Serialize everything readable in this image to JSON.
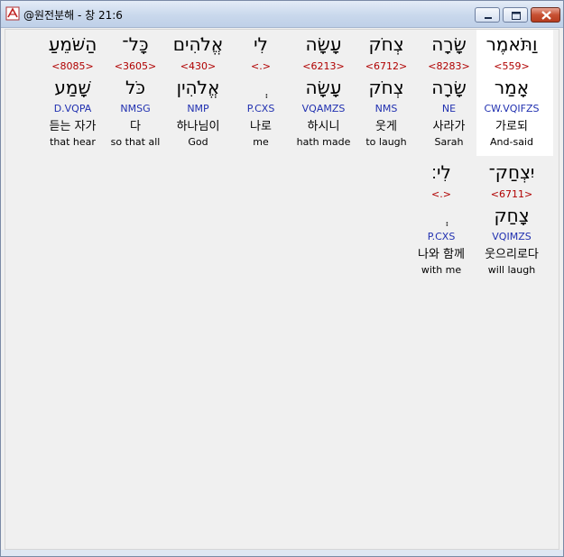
{
  "window": {
    "title": "@원전분해 - 창 21:6",
    "icon": "app-icon"
  },
  "controls": {
    "minimize": "minimize-icon",
    "maximize": "maximize-icon",
    "close": "close-icon"
  },
  "colors": {
    "strong": "#b00000",
    "morph": "#2030b0",
    "highlight": "#ffffff"
  },
  "rows": [
    [
      {
        "hebrew": "וַתֹּאמֶר",
        "strong": "<559>",
        "lemma": "אָמַר",
        "morph": "CW.VQIFZS",
        "korean": "가로되",
        "english": "And-said"
      },
      {
        "hebrew": "שָׂרָה",
        "strong": "<8283>",
        "lemma": "שָׂרָה",
        "morph": "NE",
        "korean": "사라가",
        "english": "Sarah"
      },
      {
        "hebrew": "צְחֹק",
        "strong": "<6712>",
        "lemma": "צְחֹק",
        "morph": "NMS",
        "korean": "웃게",
        "english": "to laugh"
      },
      {
        "hebrew": "עָשָׂה",
        "strong": "<6213>",
        "lemma": "עָשָׂה",
        "morph": "VQAMZS",
        "korean": "하시니",
        "english": "hath made"
      },
      {
        "hebrew": "לִי",
        "strong": "<.>",
        "lemma": "ְ",
        "morph": "P.CXS",
        "korean": "나로",
        "english": "me"
      },
      {
        "hebrew": "אֱלֹהִים",
        "strong": "<430>",
        "lemma": "אֱלֹהִין",
        "morph": "NMP",
        "korean": "하나님이",
        "english": "God"
      },
      {
        "hebrew": "כָּל־",
        "strong": "<3605>",
        "lemma": "כֹּל",
        "morph": "NMSG",
        "korean": "다",
        "english": "so that all"
      },
      {
        "hebrew": "הַשֹּׁמֵעַ",
        "strong": "<8085>",
        "lemma": "שָׁמַע",
        "morph": "D.VQPA",
        "korean": "듣는 자가",
        "english": "that hear"
      }
    ],
    [
      {
        "hebrew": "יִצְחַק־",
        "strong": "<6711>",
        "lemma": "צָחַק",
        "morph": "VQIMZS",
        "korean": "웃으리로다",
        "english": "will laugh"
      },
      {
        "hebrew": "לִי׃",
        "strong": "<.>",
        "lemma": "ְ",
        "morph": "P.CXS",
        "korean": "나와 함께",
        "english": "with me"
      }
    ]
  ]
}
